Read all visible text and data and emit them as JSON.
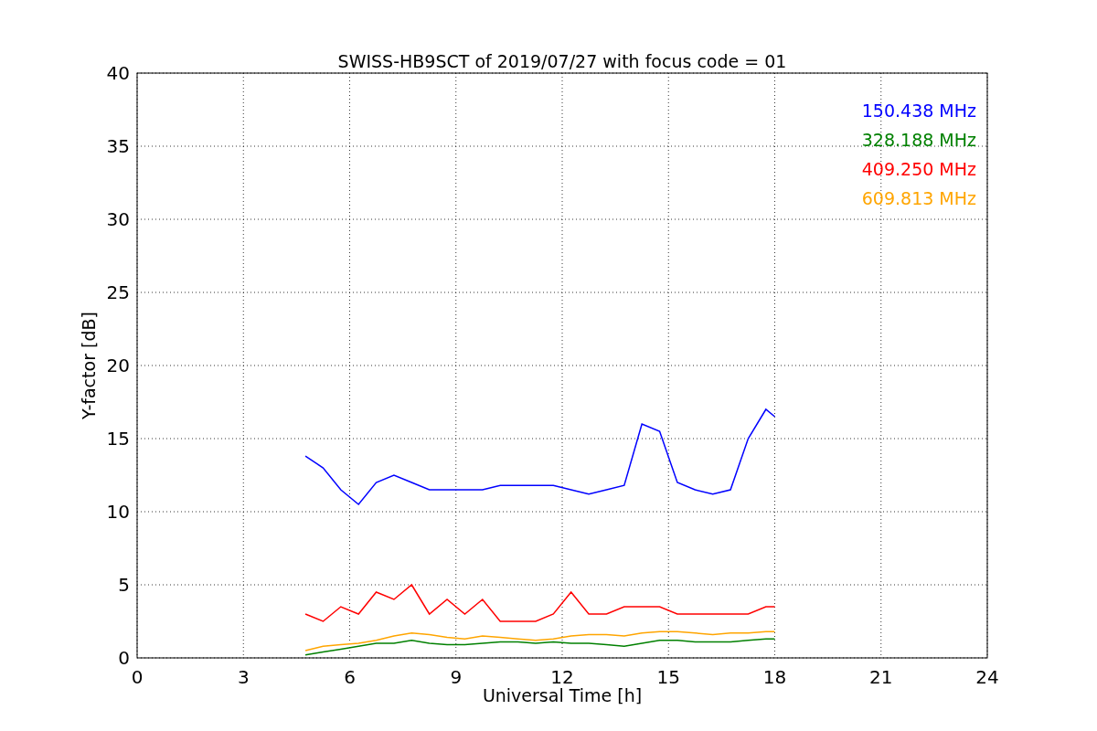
{
  "chart_data": {
    "type": "line",
    "title": "SWISS-HB9SCT of 2019/07/27 with focus code = 01",
    "xlabel": "Universal Time [h]",
    "ylabel": "Y-factor [dB]",
    "x": [
      4.75,
      5.25,
      5.75,
      6.25,
      6.75,
      7.25,
      7.75,
      8.25,
      8.75,
      9.25,
      9.75,
      10.25,
      10.75,
      11.25,
      11.75,
      12.25,
      12.75,
      13.25,
      13.75,
      14.25,
      14.75,
      15.25,
      15.75,
      16.25,
      16.75,
      17.25,
      17.75,
      18
    ],
    "series": [
      {
        "name": "150.438 MHz",
        "color": "#0000ff",
        "values": [
          13.8,
          13,
          11.5,
          10.5,
          12,
          12.5,
          12,
          11.5,
          11.5,
          11.5,
          11.5,
          11.8,
          11.8,
          11.8,
          11.8,
          11.5,
          11.2,
          11.5,
          11.8,
          16,
          15.5,
          12,
          11.5,
          11.2,
          11.5,
          15,
          17,
          16.5
        ]
      },
      {
        "name": "328.188 MHz",
        "color": "#008000",
        "values": [
          0.2,
          0.4,
          0.6,
          0.8,
          1.0,
          1.0,
          1.2,
          1.0,
          0.9,
          0.9,
          1.0,
          1.1,
          1.1,
          1.0,
          1.1,
          1.0,
          1.0,
          0.9,
          0.8,
          1.0,
          1.2,
          1.2,
          1.1,
          1.1,
          1.1,
          1.2,
          1.3,
          1.3
        ]
      },
      {
        "name": "409.250 MHz",
        "color": "#ff0000",
        "values": [
          3,
          2.5,
          3.5,
          3,
          4.5,
          4,
          5,
          3,
          4,
          3,
          4,
          2.5,
          2.5,
          2.5,
          3,
          4.5,
          3,
          3,
          3.5,
          3.5,
          3.5,
          3,
          3,
          3,
          3,
          3,
          3.5,
          3.5
        ]
      },
      {
        "name": "609.813 MHz",
        "color": "#ffa500",
        "values": [
          0.5,
          0.8,
          0.9,
          1.0,
          1.2,
          1.5,
          1.7,
          1.6,
          1.4,
          1.3,
          1.5,
          1.4,
          1.3,
          1.2,
          1.3,
          1.5,
          1.6,
          1.6,
          1.5,
          1.7,
          1.8,
          1.8,
          1.7,
          1.6,
          1.7,
          1.7,
          1.8,
          1.8
        ]
      }
    ],
    "xlim": [
      0,
      24
    ],
    "ylim": [
      0,
      40
    ],
    "xticks": [
      0,
      3,
      6,
      9,
      12,
      15,
      18,
      21,
      24
    ],
    "yticks": [
      0,
      5,
      10,
      15,
      20,
      25,
      30,
      35,
      40
    ],
    "grid": true
  }
}
